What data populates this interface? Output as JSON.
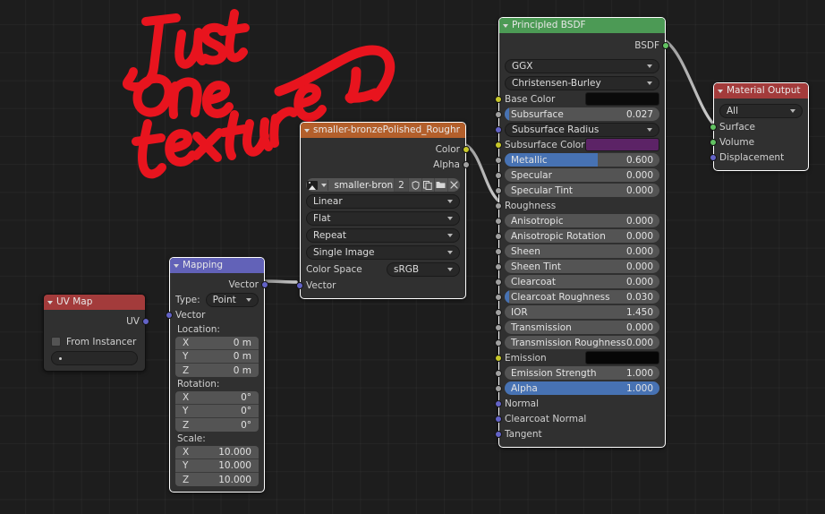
{
  "editor": {
    "background": "#1d1d1d",
    "grid": true
  },
  "annotation": {
    "text": "Just one texture",
    "color": "#e8141e",
    "has_arrow": true
  },
  "nodes": {
    "uv_map": {
      "title": "UV Map",
      "header_color": "#a33b3b",
      "outputs": [
        {
          "label": "UV",
          "socket": "purple"
        }
      ],
      "checkbox": {
        "label": "From Instancer",
        "checked": false
      },
      "uv_field_value": ""
    },
    "mapping": {
      "title": "Mapping",
      "header_color": "#6262b8",
      "outputs": [
        {
          "label": "Vector",
          "socket": "purple"
        }
      ],
      "type_label": "Type:",
      "type_value": "Point",
      "vector_input_label": "Vector",
      "location_label": "Location:",
      "location": [
        {
          "axis": "X",
          "value": "0 m"
        },
        {
          "axis": "Y",
          "value": "0 m"
        },
        {
          "axis": "Z",
          "value": "0 m"
        }
      ],
      "rotation_label": "Rotation:",
      "rotation": [
        {
          "axis": "X",
          "value": "0°"
        },
        {
          "axis": "Y",
          "value": "0°"
        },
        {
          "axis": "Z",
          "value": "0°"
        }
      ],
      "scale_label": "Scale:",
      "scale": [
        {
          "axis": "X",
          "value": "10.000"
        },
        {
          "axis": "Y",
          "value": "10.000"
        },
        {
          "axis": "Z",
          "value": "10.000"
        }
      ]
    },
    "image_texture": {
      "title": "smaller-bronzePolished_Roughness.png",
      "header_color": "#b35f2b",
      "outputs": [
        {
          "label": "Color",
          "socket": "yellow"
        },
        {
          "label": "Alpha",
          "socket": "gray"
        }
      ],
      "datablock": {
        "icon": "image-icon",
        "name": "smaller-bron…",
        "users_count": "2",
        "buttons": [
          "shield-icon",
          "copy-icon",
          "folder-icon",
          "close-icon"
        ]
      },
      "interpolation": "Linear",
      "projection": "Flat",
      "extension": "Repeat",
      "source": "Single Image",
      "color_space_label": "Color Space",
      "color_space_value": "sRGB",
      "vector_input_label": "Vector"
    },
    "principled_bsdf": {
      "title": "Principled BSDF",
      "header_color": "#4c9a55",
      "outputs": [
        {
          "label": "BSDF",
          "socket": "green"
        }
      ],
      "distribution": "GGX",
      "subsurface_method": "Christensen-Burley",
      "inputs": [
        {
          "label": "Base Color",
          "socket": "yellow",
          "kind": "color",
          "color": "#0a0a0a"
        },
        {
          "label": "Subsurface",
          "socket": "gray",
          "kind": "slider",
          "value": "0.027",
          "fill": 2.7
        },
        {
          "label": "Subsurface Radius",
          "socket": "purple",
          "kind": "dropdown",
          "value": ""
        },
        {
          "label": "Subsurface Color",
          "socket": "yellow",
          "kind": "color",
          "color": "#5c2366"
        },
        {
          "label": "Metallic",
          "socket": "gray",
          "kind": "slider",
          "value": "0.600",
          "fill": 60
        },
        {
          "label": "Specular",
          "socket": "gray",
          "kind": "slider",
          "value": "0.000",
          "fill": 0
        },
        {
          "label": "Specular Tint",
          "socket": "gray",
          "kind": "slider",
          "value": "0.000",
          "fill": 0
        },
        {
          "label": "Roughness",
          "socket": "gray",
          "kind": "linked",
          "value": ""
        },
        {
          "label": "Anisotropic",
          "socket": "gray",
          "kind": "slider",
          "value": "0.000",
          "fill": 0
        },
        {
          "label": "Anisotropic Rotation",
          "socket": "gray",
          "kind": "slider",
          "value": "0.000",
          "fill": 0
        },
        {
          "label": "Sheen",
          "socket": "gray",
          "kind": "slider",
          "value": "0.000",
          "fill": 0
        },
        {
          "label": "Sheen Tint",
          "socket": "gray",
          "kind": "slider",
          "value": "0.000",
          "fill": 0
        },
        {
          "label": "Clearcoat",
          "socket": "gray",
          "kind": "slider",
          "value": "0.000",
          "fill": 0
        },
        {
          "label": "Clearcoat Roughness",
          "socket": "gray",
          "kind": "slider",
          "value": "0.030",
          "fill": 3
        },
        {
          "label": "IOR",
          "socket": "gray",
          "kind": "slider",
          "value": "1.450",
          "fill": 0
        },
        {
          "label": "Transmission",
          "socket": "gray",
          "kind": "slider",
          "value": "0.000",
          "fill": 0
        },
        {
          "label": "Transmission Roughness",
          "socket": "gray",
          "kind": "slider",
          "value": "0.000",
          "fill": 0
        },
        {
          "label": "Emission",
          "socket": "yellow",
          "kind": "color",
          "color": "#060606"
        },
        {
          "label": "Emission Strength",
          "socket": "gray",
          "kind": "slider",
          "value": "1.000",
          "fill": 0
        },
        {
          "label": "Alpha",
          "socket": "gray",
          "kind": "slider",
          "value": "1.000",
          "fill": 100
        },
        {
          "label": "Normal",
          "socket": "purple",
          "kind": "plain",
          "value": ""
        },
        {
          "label": "Clearcoat Normal",
          "socket": "purple",
          "kind": "plain",
          "value": ""
        },
        {
          "label": "Tangent",
          "socket": "purple",
          "kind": "plain",
          "value": ""
        }
      ]
    },
    "material_output": {
      "title": "Material Output",
      "header_color": "#a33b3b",
      "target": "All",
      "inputs": [
        {
          "label": "Surface",
          "socket": "green"
        },
        {
          "label": "Volume",
          "socket": "green"
        },
        {
          "label": "Displacement",
          "socket": "purple"
        }
      ]
    }
  }
}
